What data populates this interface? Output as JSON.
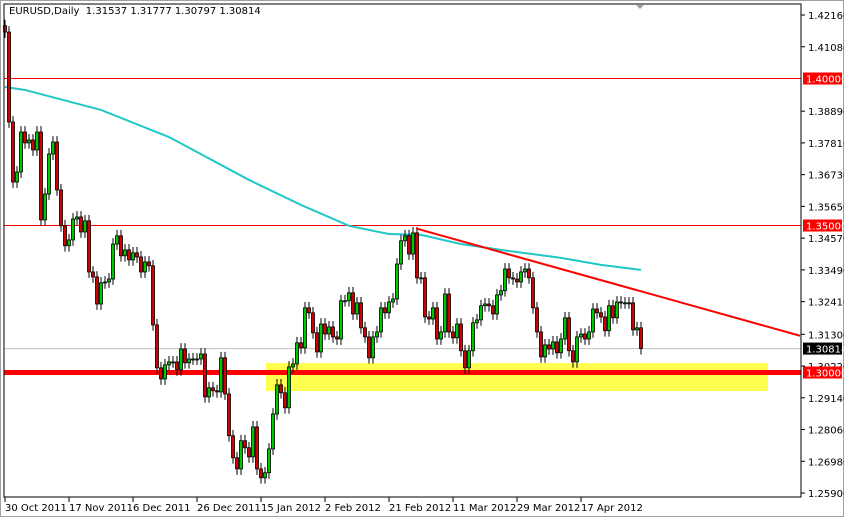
{
  "header": {
    "symbol_timeframe": "EURUSD,Daily",
    "ohlc": "1.31537 1.31777 1.30797 1.30814"
  },
  "colors": {
    "bull": "#00c800",
    "bear": "#d00000",
    "ma": "#20c8c8",
    "level": "#ff0000",
    "zone": "#ffff50",
    "current": "#c0c0c0"
  },
  "y_axis": {
    "labels": [
      "1.42160",
      "1.41080",
      "1.38890",
      "1.37810",
      "1.36730",
      "1.35650",
      "1.34570",
      "1.33490",
      "1.32410",
      "1.31300",
      "1.30220",
      "1.29140",
      "1.28060",
      "1.26980",
      "1.25900"
    ],
    "range": [
      1.259,
      1.4216
    ]
  },
  "x_axis": {
    "labels": [
      {
        "text": "30 Oct 2011",
        "index": 0
      },
      {
        "text": "17 Nov 2011",
        "index": 16
      },
      {
        "text": "6 Dec 2011",
        "index": 32
      },
      {
        "text": "26 Dec 2011",
        "index": 48
      },
      {
        "text": "15 Jan 2012",
        "index": 64
      },
      {
        "text": "2 Feb 2012",
        "index": 80
      },
      {
        "text": "21 Feb 2012",
        "index": 96
      },
      {
        "text": "11 Mar 2012",
        "index": 112
      },
      {
        "text": "29 Mar 2012",
        "index": 128
      },
      {
        "text": "17 Apr 2012",
        "index": 144
      }
    ]
  },
  "levels": [
    {
      "price": 1.4,
      "label": "1.40000",
      "kind": "thin"
    },
    {
      "price": 1.35,
      "label": "1.35000",
      "kind": "thin"
    },
    {
      "price": 1.3,
      "label": "1.30000",
      "kind": "thick"
    }
  ],
  "current_price": {
    "price": 1.30814,
    "label": "1.30814"
  },
  "support_zone": {
    "from_index": 65.25,
    "to_index": 190.75,
    "top": 1.3032,
    "bottom": 1.2937
  },
  "trendline": {
    "start": {
      "index": 102.75,
      "price": 1.349
    },
    "end": {
      "index": 198.75,
      "price": 1.3125
    }
  },
  "chart_data": {
    "type": "candlestick",
    "title": "EURUSD,Daily",
    "first_open": 1.418,
    "closes": [
      1.4158,
      1.3852,
      1.3648,
      1.3682,
      1.3818,
      1.3781,
      1.3791,
      1.3757,
      1.3818,
      1.3519,
      1.3607,
      1.3743,
      1.3784,
      1.3621,
      1.3499,
      1.3431,
      1.3451,
      1.3522,
      1.3529,
      1.3478,
      1.3516,
      1.3342,
      1.3325,
      1.3233,
      1.3305,
      1.3308,
      1.3318,
      1.3437,
      1.3465,
      1.3397,
      1.3417,
      1.3383,
      1.3407,
      1.3393,
      1.3342,
      1.3376,
      1.3363,
      1.3162,
      1.3016,
      1.2978,
      1.3026,
      1.3036,
      1.3036,
      1.3009,
      1.308,
      1.3033,
      1.3046,
      1.3046,
      1.3046,
      1.3063,
      1.2917,
      1.2948,
      1.2938,
      1.2934,
      1.305,
      1.2927,
      1.2785,
      1.271,
      1.2672,
      1.2768,
      1.2744,
      1.2713,
      1.2815,
      1.2672,
      1.2642,
      1.2659,
      1.274,
      1.2859,
      1.2958,
      1.2931,
      1.288,
      1.3019,
      1.3029,
      1.3101,
      1.3084,
      1.322,
      1.3203,
      1.3135,
      1.307,
      1.3165,
      1.3131,
      1.3155,
      1.3121,
      1.3114,
      1.3244,
      1.3244,
      1.3271,
      1.3199,
      1.3237,
      1.3152,
      1.3121,
      1.305,
      1.3121,
      1.3138,
      1.322,
      1.3203,
      1.324,
      1.325,
      1.3369,
      1.3448,
      1.3465,
      1.3403,
      1.3475,
      1.3322,
      1.3322,
      1.3189,
      1.3182,
      1.322,
      1.3114,
      1.3138,
      1.3267,
      1.3138,
      1.3118,
      1.3165,
      1.3074,
      1.3016,
      1.3074,
      1.3169,
      1.3179,
      1.3227,
      1.3233,
      1.3227,
      1.3199,
      1.3264,
      1.3278,
      1.3352,
      1.3322,
      1.3318,
      1.3308,
      1.3342,
      1.3352,
      1.3322,
      1.322,
      1.3138,
      1.3053,
      1.3094,
      1.308,
      1.3104,
      1.3067,
      1.3114,
      1.3186,
      1.3074,
      1.3036,
      1.3121,
      1.3131,
      1.3114,
      1.3138,
      1.3216,
      1.3203,
      1.3189,
      1.3142,
      1.3227,
      1.3186,
      1.324,
      1.3237,
      1.3237,
      1.3237,
      1.3145,
      1.3152,
      1.30814
    ],
    "moving_average": [
      [
        0,
        1.3971
      ],
      [
        5,
        1.3961
      ],
      [
        24,
        1.3893
      ],
      [
        41,
        1.3801
      ],
      [
        61,
        1.3655
      ],
      [
        74,
        1.357
      ],
      [
        86,
        1.3499
      ],
      [
        96,
        1.3471
      ],
      [
        104,
        1.3468
      ],
      [
        114,
        1.3437
      ],
      [
        124,
        1.3417
      ],
      [
        139,
        1.339
      ],
      [
        149,
        1.3366
      ],
      [
        159,
        1.3349
      ]
    ]
  }
}
